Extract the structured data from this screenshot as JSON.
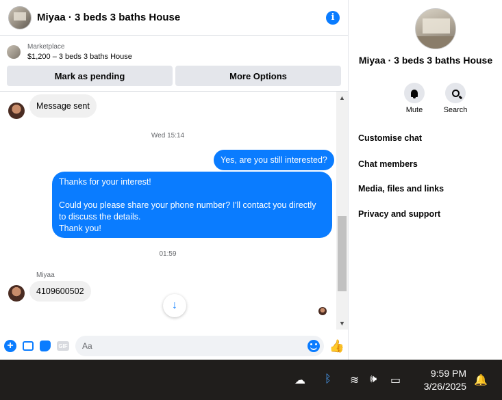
{
  "header": {
    "title": "Miyaa · 3 beds 3 baths House",
    "info_icon": "info-icon"
  },
  "listing": {
    "source": "Marketplace",
    "summary": "$1,200 – 3 beds 3 baths House",
    "mark_pending_label": "Mark as pending",
    "more_options_label": "More Options"
  },
  "messages": {
    "first_incoming": "Message sent",
    "timestamp_1": "Wed 15:14",
    "outgoing_1": "Yes, are you still interested?",
    "outgoing_2_line1": "Thanks for your interest!",
    "outgoing_2_line2": "Could you please share your phone number? I'll contact you directly",
    "outgoing_2_line3": "to discuss the details.",
    "outgoing_2_line4": "Thank you!",
    "timestamp_2": "01:59",
    "sender_name": "Miyaa",
    "incoming_2": "4109600502"
  },
  "composer": {
    "placeholder": "Aa",
    "gif_label": "GIF"
  },
  "info_panel": {
    "name": "Miyaa · 3 beds 3 baths House",
    "mute_label": "Mute",
    "search_label": "Search",
    "menu": [
      "Customise chat",
      "Chat members",
      "Media, files and links",
      "Privacy and support"
    ]
  },
  "taskbar": {
    "time": "9:59 PM",
    "date": "3/26/2025"
  },
  "colors": {
    "accent": "#0a7cff",
    "bubble_in": "#f0f0f0",
    "taskbar": "#201e1c"
  }
}
